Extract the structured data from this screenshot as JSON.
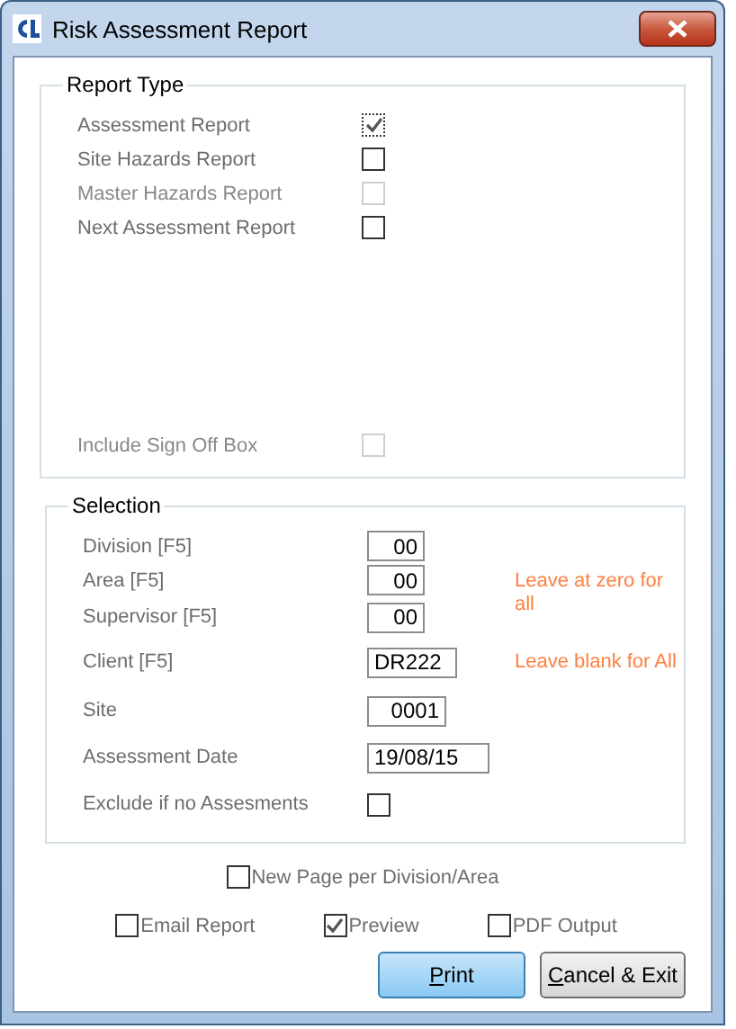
{
  "window": {
    "title": "Risk Assessment Report"
  },
  "report_type": {
    "title": "Report Type",
    "options": [
      {
        "label": "Assessment Report",
        "checked": true,
        "disabled": false,
        "focused": true
      },
      {
        "label": "Site Hazards Report",
        "checked": false,
        "disabled": false,
        "focused": false
      },
      {
        "label": "Master Hazards Report",
        "checked": false,
        "disabled": true,
        "focused": false
      },
      {
        "label": "Next Assessment Report",
        "checked": false,
        "disabled": false,
        "focused": false
      }
    ],
    "include_sign_off": {
      "label": "Include Sign Off Box",
      "checked": false,
      "disabled": true
    }
  },
  "selection": {
    "title": "Selection",
    "rows": [
      {
        "kind": "field",
        "label": "Division [F5]",
        "value": "00"
      },
      {
        "kind": "field",
        "label": "Area [F5]",
        "value": "00",
        "hint": "Leave at zero for all"
      },
      {
        "kind": "field",
        "label": "Supervisor [F5]",
        "value": "00"
      },
      {
        "kind": "field",
        "label": "Client [F5]",
        "value": "DR222",
        "hint": "Leave blank for All"
      },
      {
        "kind": "field",
        "label": "Site",
        "value": "0001"
      },
      {
        "kind": "field",
        "label": "Assessment Date",
        "value": "19/08/15"
      },
      {
        "kind": "checkbox",
        "label": "Exclude if no Assesments",
        "checked": false
      }
    ]
  },
  "new_page_option": {
    "label": "New Page per Division/Area",
    "checked": false
  },
  "output_options": [
    {
      "label": "Email Report",
      "checked": false
    },
    {
      "label": "Preview",
      "checked": true
    },
    {
      "label": "PDF Output",
      "checked": false
    }
  ],
  "buttons": [
    {
      "label": "Print",
      "kind": "default"
    },
    {
      "label": "Cancel & Exit",
      "kind": "normal"
    }
  ]
}
